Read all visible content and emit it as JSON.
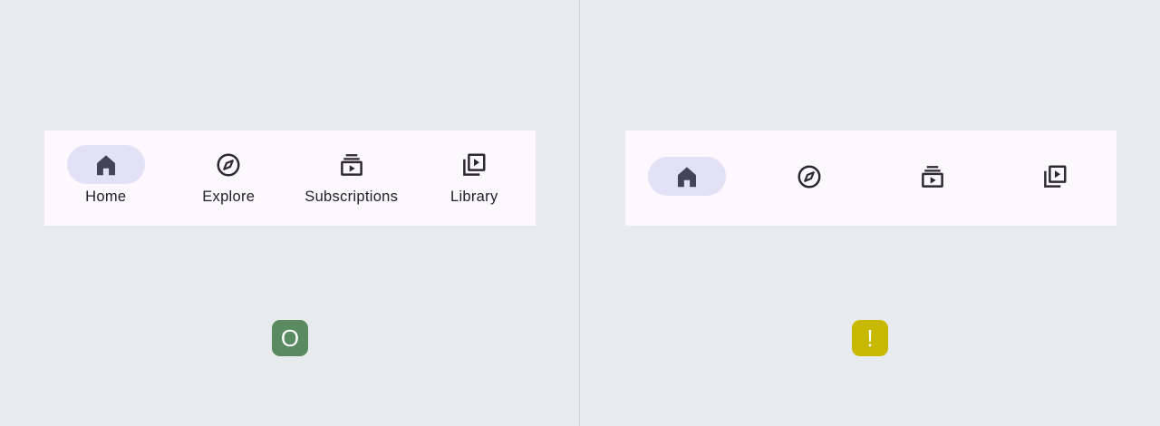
{
  "panels": {
    "labeled": {
      "items": [
        {
          "label": "Home",
          "icon": "home-icon",
          "active": true
        },
        {
          "label": "Explore",
          "icon": "compass-icon",
          "active": false
        },
        {
          "label": "Subscriptions",
          "icon": "subscriptions-icon",
          "active": false
        },
        {
          "label": "Library",
          "icon": "video-library-icon",
          "active": false
        }
      ],
      "badge": {
        "glyph": "O",
        "status": "good",
        "color": "#5a8a60"
      }
    },
    "unlabeled": {
      "items": [
        {
          "icon": "home-icon",
          "active": true
        },
        {
          "icon": "compass-icon",
          "active": false
        },
        {
          "icon": "subscriptions-icon",
          "active": false
        },
        {
          "icon": "video-library-icon",
          "active": false
        }
      ],
      "badge": {
        "glyph": "!",
        "status": "warning",
        "color": "#c8b800"
      }
    }
  },
  "colors": {
    "background": "#e8ebee",
    "navbar_surface": "#fdf7fe",
    "active_indicator": "#e3e1f6",
    "icon": "#45435a",
    "label": "#22212a"
  }
}
